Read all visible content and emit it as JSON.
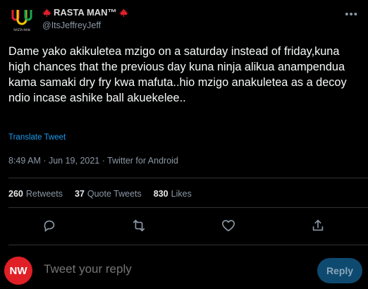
{
  "author": {
    "display_name": "RASTA MAN™",
    "handle": "@ItsJeffreyJeff",
    "flag_icon": "maple-leaf-icon",
    "avatar_icon": "uwu-logo-icon",
    "avatar_caption": "RASTA MAN"
  },
  "tweet": {
    "text": "Dame yako akikuletea mzigo on a saturday instead of friday,kuna high chances that the previous day kuna ninja alikua anampendua kama samaki dry fry kwa mafuta..hio mzigo anakuletea as a decoy ndio incase ashike ball akuekelee..",
    "translate_label": "Translate Tweet",
    "meta": "8:49 AM · Jun 19, 2021 · Twitter for Android"
  },
  "stats": {
    "retweets_count": "260",
    "retweets_label": "Retweets",
    "quotes_count": "37",
    "quotes_label": "Quote Tweets",
    "likes_count": "830",
    "likes_label": "Likes"
  },
  "reply": {
    "avatar_text": "NW",
    "placeholder": "Tweet your reply",
    "button_label": "Reply"
  },
  "colors": {
    "background": "#000000",
    "accent": "#1d9bf0",
    "muted": "#8b98a5",
    "reply_button": "#0e4a70",
    "nw_red": "#e01f26"
  }
}
